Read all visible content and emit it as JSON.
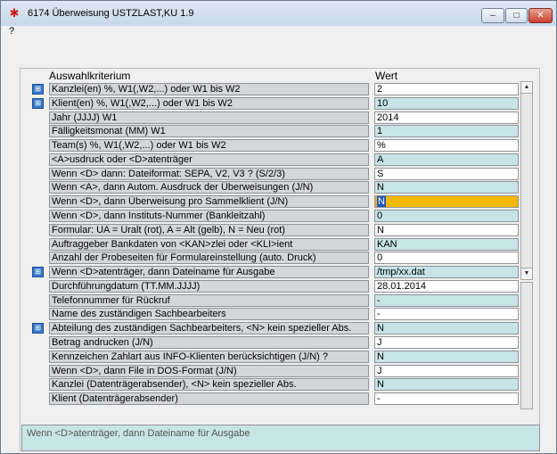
{
  "window": {
    "title": "6174 Überweisung USTZLAST,KU 1.9",
    "app_icon": "red-swoosh-icon",
    "menu_help": "?",
    "btn_min": "–",
    "btn_max": "□",
    "btn_close": "✕"
  },
  "header": {
    "criterion": "Auswahlkriterium",
    "value": "Wert"
  },
  "rows": [
    {
      "label": "Kanzlei(en)  %, W1(,W2,...) oder W1 bis W2",
      "value": "2",
      "icon": true,
      "style": "white"
    },
    {
      "label": "Klient(en)  %, W1(,W2,...) oder W1 bis W2",
      "value": "10",
      "icon": true,
      "style": "cyan"
    },
    {
      "label": "Jahr (JJJJ)     W1",
      "value": "2014",
      "icon": false,
      "style": "white"
    },
    {
      "label": "Fälligkeitsmonat (MM)     W1",
      "value": "1",
      "icon": false,
      "style": "cyan"
    },
    {
      "label": "Team(s)  %, W1(,W2,...) oder W1 bis W2",
      "value": "%",
      "icon": false,
      "style": "white"
    },
    {
      "label": "<A>usdruck oder <D>atenträger",
      "value": "A",
      "icon": false,
      "style": "cyan"
    },
    {
      "label": "  Wenn <D> dann: Dateiformat: SEPA, V2, V3 ?  (S/2/3)",
      "value": "S",
      "icon": false,
      "style": "white"
    },
    {
      "label": "Wenn <A>, dann Autom. Ausdruck der Überweisungen (J/N)",
      "value": "N",
      "icon": false,
      "style": "cyan"
    },
    {
      "label": "Wenn <D>, dann Überweisung pro Sammelklient (J/N)",
      "value": "N",
      "icon": false,
      "style": "active"
    },
    {
      "label": "Wenn <D>, dann Instituts-Nummer  (Bankleitzahl)",
      "value": "0",
      "icon": false,
      "style": "cyan"
    },
    {
      "label": "Formular: UA = Uralt (rot), A = Alt (gelb), N = Neu (rot)",
      "value": "N",
      "icon": false,
      "style": "white"
    },
    {
      "label": "Auftraggeber Bankdaten von <KAN>zlei oder <KLI>ient",
      "value": "KAN",
      "icon": false,
      "style": "cyan"
    },
    {
      "label": "Anzahl der Probeseiten für Formulareinstellung (auto. Druck)",
      "value": "0",
      "icon": false,
      "style": "white"
    },
    {
      "label": "Wenn <D>atenträger, dann Dateiname für Ausgabe",
      "value": "/tmp/xx.dat",
      "icon": true,
      "style": "cyan"
    },
    {
      "label": "Durchführungdatum (TT.MM.JJJJ)",
      "value": "28.01.2014",
      "icon": false,
      "style": "white"
    },
    {
      "label": "Telefonnummer für Rückruf",
      "value": "-",
      "icon": false,
      "style": "cyan"
    },
    {
      "label": "Name des zuständigen Sachbearbeiters",
      "value": "-",
      "icon": false,
      "style": "white"
    },
    {
      "label": "Abteilung des zuständigen Sachbearbeiters, <N> kein spezieller Abs.",
      "value": "N",
      "icon": true,
      "style": "cyan"
    },
    {
      "label": "Betrag andrucken (J/N)",
      "value": "J",
      "icon": false,
      "style": "white"
    },
    {
      "label": "Kennzeichen Zahlart aus INFO-Klienten berücksichtigen (J/N) ?",
      "value": "N",
      "icon": false,
      "style": "cyan"
    },
    {
      "label": "Wenn <D>, dann File in DOS-Format (J/N)",
      "value": "J",
      "icon": false,
      "style": "white"
    },
    {
      "label": "Kanzlei (Datenträgerabsender), <N> kein spezieller Abs.",
      "value": "N",
      "icon": false,
      "style": "cyan"
    },
    {
      "label": "Klient (Datenträgerabsender)",
      "value": "-",
      "icon": false,
      "style": "white"
    }
  ],
  "status": {
    "text": "Wenn <D>atenträger, dann Dateiname für Ausgabe"
  }
}
